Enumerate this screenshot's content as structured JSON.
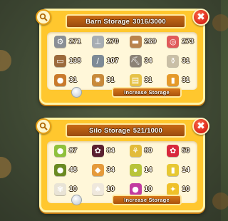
{
  "barn": {
    "title": "Barn Storage",
    "capacity": "3016/3000",
    "button_label": "Increase Storage",
    "items": [
      {
        "icon": "bolt-icon",
        "color": "#8a8f95",
        "glyph": "⚙",
        "count": "271"
      },
      {
        "icon": "nail-icon",
        "color": "#a7adb3",
        "glyph": "⊥",
        "count": "270"
      },
      {
        "icon": "wood-plank-icon",
        "color": "#b9834d",
        "glyph": "▬",
        "count": "269"
      },
      {
        "icon": "tape-icon",
        "color": "#e05a5a",
        "glyph": "◎",
        "count": "273"
      },
      {
        "icon": "plank-icon",
        "color": "#9b6a3c",
        "glyph": "▭",
        "count": "138"
      },
      {
        "icon": "screwdriver-icon",
        "color": "#7d8a96",
        "glyph": "/",
        "count": "107"
      },
      {
        "icon": "pickaxe-icon",
        "color": "#8b8276",
        "glyph": "⛏",
        "count": "34"
      },
      {
        "icon": "shovel-icon",
        "color": "#c9bfa6",
        "glyph": "⚱",
        "count": "31"
      },
      {
        "icon": "burger-icon",
        "color": "#c97a2b",
        "glyph": "●",
        "count": "31"
      },
      {
        "icon": "cookie-icon",
        "color": "#c88a3a",
        "glyph": "✹",
        "count": "31"
      },
      {
        "icon": "popcorn-icon",
        "color": "#e6c248",
        "glyph": "▤",
        "count": "31"
      },
      {
        "icon": "juice-bottle-icon",
        "color": "#e59a2a",
        "glyph": "▮",
        "count": "31"
      }
    ]
  },
  "silo": {
    "title": "Silo Storage",
    "capacity": "521/1000",
    "button_label": "Increase Storage",
    "items": [
      {
        "icon": "apple-icon",
        "color": "#8fc13c",
        "glyph": "●",
        "count": "87"
      },
      {
        "icon": "blackberry-icon",
        "color": "#5a2030",
        "glyph": "✿",
        "count": "84"
      },
      {
        "icon": "wheat-icon",
        "color": "#e2bb3a",
        "glyph": "⚘",
        "count": "80"
      },
      {
        "icon": "raspberry-icon",
        "color": "#d8283c",
        "glyph": "✿",
        "count": "50"
      },
      {
        "icon": "olive-icon",
        "color": "#6a8a22",
        "glyph": "●",
        "count": "48"
      },
      {
        "icon": "pizza-icon",
        "color": "#e59a3a",
        "glyph": "◆",
        "count": "34"
      },
      {
        "icon": "soybean-icon",
        "color": "#b8c43a",
        "glyph": "⦁",
        "count": "14"
      },
      {
        "icon": "corn-icon",
        "color": "#e7c833",
        "glyph": "▮",
        "count": "14"
      },
      {
        "icon": "cotton-icon",
        "color": "#e9e4d6",
        "glyph": "✾",
        "count": "10"
      },
      {
        "icon": "garlic-icon",
        "color": "#efe8dc",
        "glyph": "♠",
        "count": "10"
      },
      {
        "icon": "cabbage-icon",
        "color": "#c23ca0",
        "glyph": "●",
        "count": "10"
      },
      {
        "icon": "carrot-icon",
        "color": "#efc12a",
        "glyph": "✦",
        "count": "10"
      }
    ]
  }
}
